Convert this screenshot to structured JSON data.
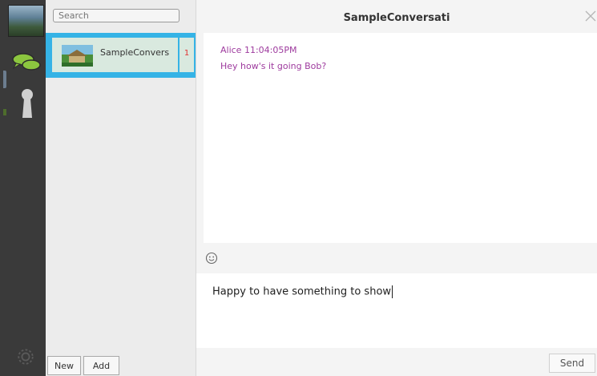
{
  "sidebar": {
    "icons": [
      "avatar-icon",
      "chat-bubbles-icon",
      "key-icon",
      "gear-icon"
    ]
  },
  "contacts": {
    "search_placeholder": "Search",
    "items": [
      {
        "name": "SampleConvers",
        "unread": "1"
      }
    ],
    "new_label": "New",
    "add_label": "Add"
  },
  "conversation": {
    "title": "SampleConversati",
    "messages": [
      {
        "meta": "Alice 11:04:05PM",
        "text": "Hey how's it going Bob?"
      }
    ],
    "draft": "Happy to have something to show",
    "send_label": "Send"
  },
  "colors": {
    "accent": "#35b3e6",
    "message_text": "#9e3b9e",
    "unread": "#e03131"
  }
}
